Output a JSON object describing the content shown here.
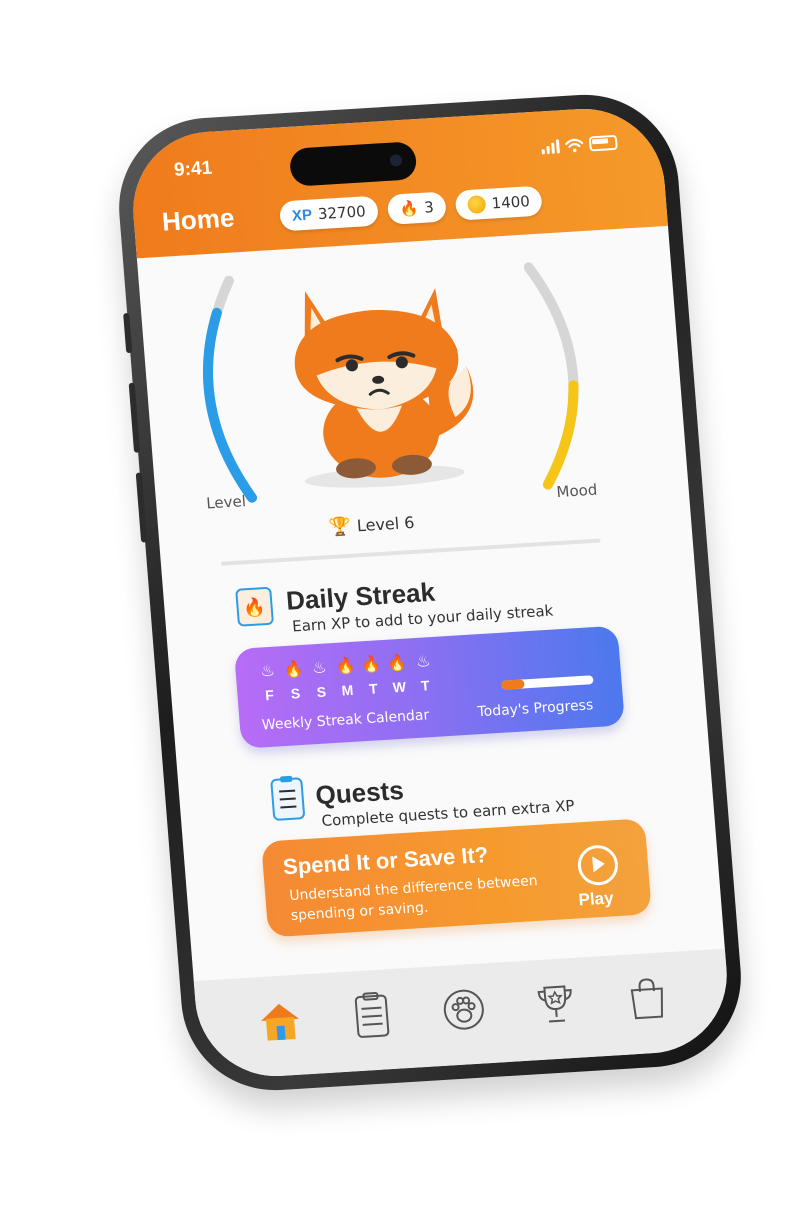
{
  "status_bar": {
    "time": "9:41"
  },
  "header": {
    "title": "Home",
    "xp": {
      "tag": "XP",
      "value": "32700"
    },
    "streak": {
      "value": "3"
    },
    "coins": {
      "value": "1400"
    }
  },
  "pet": {
    "level_label": "Level",
    "mood_label": "Mood",
    "level_text": "Level 6",
    "level_fraction": 0.85,
    "mood_fraction": 0.45
  },
  "daily_streak": {
    "title": "Daily Streak",
    "subtitle": "Earn XP to add to your daily streak",
    "days": [
      {
        "letter": "F",
        "done": false
      },
      {
        "letter": "S",
        "done": true
      },
      {
        "letter": "S",
        "done": false
      },
      {
        "letter": "M",
        "done": true
      },
      {
        "letter": "T",
        "done": true
      },
      {
        "letter": "W",
        "done": true
      },
      {
        "letter": "T",
        "done": false
      }
    ],
    "calendar_label": "Weekly Streak Calendar",
    "progress_label": "Today's Progress",
    "progress_fraction": 0.25
  },
  "quests": {
    "title": "Quests",
    "subtitle": "Complete quests to earn extra XP",
    "card": {
      "title": "Spend It or Save It?",
      "description": "Understand the difference between spending or saving.",
      "action": "Play"
    }
  },
  "colors": {
    "brand_orange": "#f07b1c",
    "level_blue": "#2b9de8",
    "mood_yellow": "#f5c518",
    "streak_purple": "#9b6ff3"
  },
  "tabbar": {
    "active": "home",
    "items": [
      "home-icon",
      "clipboard-icon",
      "paw-icon",
      "trophy-icon",
      "shopping-bag-icon"
    ]
  }
}
